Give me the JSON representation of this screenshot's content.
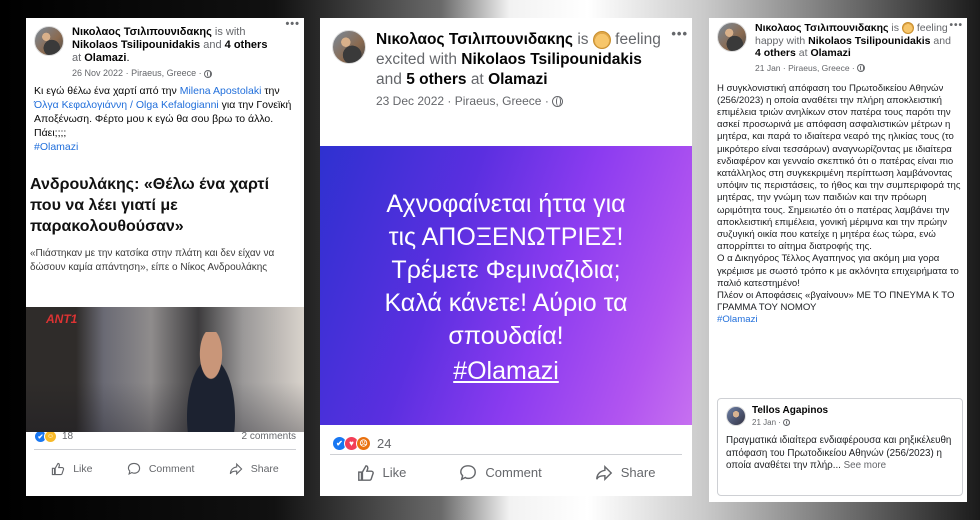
{
  "left_post": {
    "author": "Νικολαος Τσιλιπουνιδακης",
    "with_prefix": "is with",
    "with_name": "Nikolaos Tsilipounidakis",
    "and_text": "and",
    "others": "4 others",
    "at_text": "at",
    "place": "Olamazi",
    "period": ".",
    "date": "26 Nov 2022",
    "separator": "·",
    "location": "Piraeus, Greece",
    "text_1": "Κι εγώ θέλω ένα χαρτί από την",
    "mention_1": "Milena Apostolaki",
    "text_2": "την",
    "mention_2": "Όλγα Κεφαλογιάννη / Olga Kefalogianni",
    "text_3": "για την Γονεϊκή Αποξένωση. Φέρτο μου κ εγώ θα σου βρω το άλλο. Πάει;;;;",
    "hashtag": "#Olamazi",
    "news_headline": "Ανδρουλάκης: «Θέλω ένα χαρτί που να λέει γιατί με παρακολουθούσαν»",
    "news_sub": "«Πιάστηκαν με την κατσίκα στην πλάτη και δεν είχαν να δώσουν καμία απάντηση», είπε ο Νίκος Ανδρουλάκης",
    "tv_logo": "ANT1",
    "reaction_count": "18",
    "comments": "2 comments",
    "actions": {
      "like": "Like",
      "comment": "Comment",
      "share": "Share"
    }
  },
  "mid_post": {
    "author": "Νικολαος Τσιλιπουνιδακης",
    "is": "is",
    "feeling": "feeling excited with",
    "with_name": "Nikolaos Tsilipounidakis",
    "and_text": "and",
    "others": "5 others",
    "at_text": "at",
    "place": "Olamazi",
    "date": "23 Dec 2022",
    "separator": "·",
    "location": "Piraeus, Greece",
    "banner_lines": [
      "Αχνοφαίνεται ήττα για",
      "τις ΑΠΟΞΕΝΩΤΡΙΕΣ!",
      "Τρέμετε Φεμιναζιδια;",
      "Καλά κάνετε! Αύριο τα",
      "σπουδαία!"
    ],
    "banner_tag": "#Olamazi",
    "reaction_count": "24",
    "actions": {
      "like": "Like",
      "comment": "Comment",
      "share": "Share"
    }
  },
  "right_post": {
    "author": "Νικολαος Τσιλιπουνιδακης",
    "is": "is",
    "feeling": "feeling happy with",
    "with_name": "Nikolaos Tsilipounidakis",
    "and_text": "and",
    "others": "4 others",
    "at_text": "at",
    "place": "Olamazi",
    "date": "21 Jan",
    "separator": "·",
    "location": "Piraeus, Greece",
    "paragraph_1": "Η συγκλονιστική απόφαση του Πρωτοδικείου Αθηνών (256/2023) η οποία αναθέτει την πλήρη αποκλειστική επιμέλεια τριών ανηλίκων στον πατέρα τους παρότι την ασκεί προσωρινά με απόφαση ασφαλιστικών μέτρων η μητέρα, και παρά το ιδιαίτερα νεαρό της ηλικίας τους (το μικρότερο είναι τεσσάρων) αναγνωρίζοντας με ιδιαίτερα ενδιαφέρον και γενναίο σκεπτικό ότι ο πατέρας είναι πιο κατάλληλος στη συγκεκριμένη περίπτωση λαμβάνοντας υπόψιν τις περιστάσεις, το ήθος και την συμπεριφορά της μητέρας, την γνώμη των παιδιών και την πρόωρη ωριμότητα τους. Σημειωτέο ότι ο πατέρας λαμβάνει την αποκλειστική επιμέλεια, γονική μέριμνα και την πρώην συζυγική οικία που κατείχε η μητέρα έως τώρα, ενώ απορρίπτει το αίτημα διατροφής της.",
    "paragraph_2": "Ο α Δικηγόρος Τέλλος Αγαπηνος για ακόμη μια γορα γκρέμισε με σωστό τρόπο κ με ακλόνητα επιχειρήματα το παλιό κατεστημένο!",
    "paragraph_3": "Πλέον οι Αποφάσεις «βγαίνουν» ΜΕ ΤΟ ΠΝΕΥΜΑ Κ ΤΟ ΓΡΑΜΜΑ ΤΟΥ ΝΟΜΟΥ",
    "hashtag": "#Olamazi",
    "shared": {
      "name": "Tellos Agapinos",
      "date": "21 Jan",
      "separator": "·",
      "text": "Πραγματικά ιδιαίτερα ενδιαφέρουσα και ρηξικέλευθη απόφαση του Πρωτοδικείου Αθηνών (256/2023) η οποία αναθέτει την πλήρ...",
      "see_more": "See more"
    }
  },
  "more_icon": "•••"
}
